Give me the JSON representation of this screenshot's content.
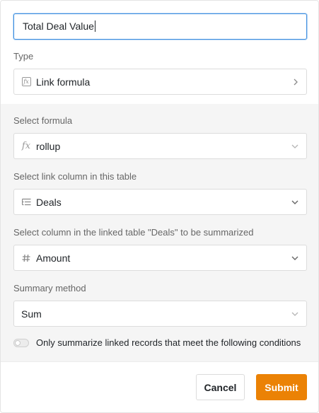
{
  "dialog": {
    "column_name": {
      "value": "Total Deal Value"
    },
    "type": {
      "label": "Type",
      "value": "Link formula",
      "icon": "formula-box-icon"
    },
    "formula": {
      "label": "Select formula",
      "value": "rollup",
      "icon": "fx-icon"
    },
    "link_column": {
      "label": "Select link column in this table",
      "value": "Deals",
      "icon": "link-list-icon"
    },
    "summarized_column": {
      "label": "Select column in the linked table \"Deals\" to be summarized",
      "value": "Amount",
      "icon": "hash-icon"
    },
    "summary_method": {
      "label": "Summary method",
      "value": "Sum"
    },
    "condition_toggle": {
      "label": "Only summarize linked records that meet the following conditions",
      "checked": false
    },
    "buttons": {
      "cancel": "Cancel",
      "submit": "Submit"
    }
  },
  "colors": {
    "accent": "#eb8205",
    "focus": "#3f8fe0",
    "section_bg": "#f5f5f5"
  }
}
